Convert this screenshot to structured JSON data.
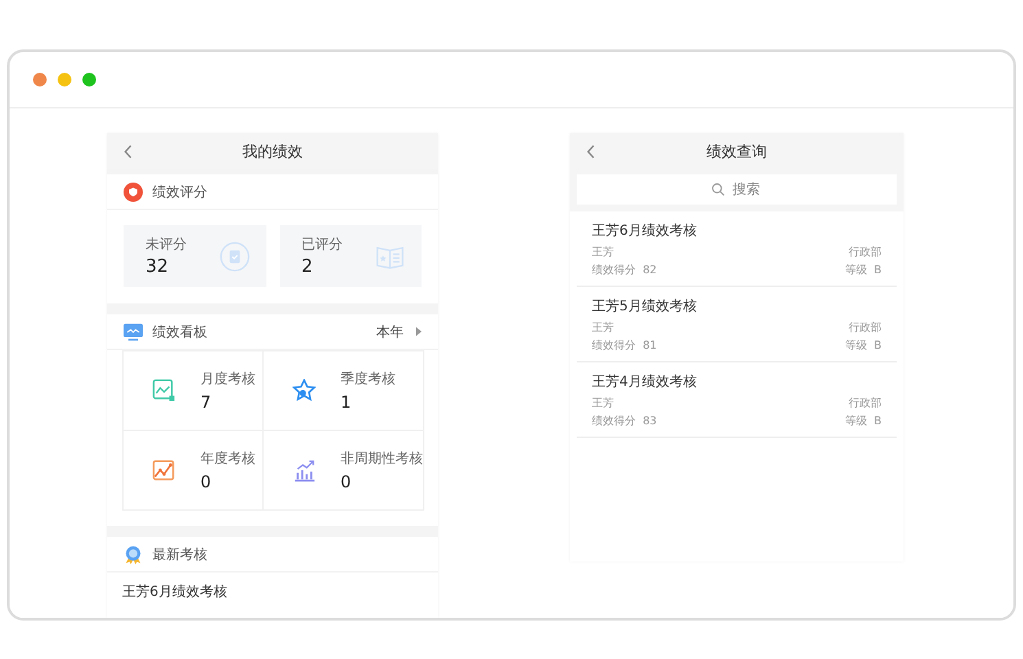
{
  "window": {
    "controls": [
      {
        "color": "#f0874a"
      },
      {
        "color": "#f5c211"
      },
      {
        "color": "#1ec31e"
      }
    ]
  },
  "left_panel": {
    "title": "我的绩效",
    "score_section": {
      "title": "绩效评分",
      "cards": [
        {
          "label": "未评分",
          "value": "32",
          "kind": "clipboard"
        },
        {
          "label": "已评分",
          "value": "2",
          "kind": "book"
        }
      ]
    },
    "board": {
      "title": "绩效看板",
      "period": "本年",
      "tiles": [
        {
          "label": "月度考核",
          "value": "7",
          "kind": "monthly"
        },
        {
          "label": "季度考核",
          "value": "1",
          "kind": "quarterly"
        },
        {
          "label": "年度考核",
          "value": "0",
          "kind": "yearly"
        },
        {
          "label": "非周期性考核",
          "value": "0",
          "kind": "irregular"
        }
      ]
    },
    "latest": {
      "title": "最新考核",
      "items": [
        "王芳6月绩效考核"
      ]
    }
  },
  "right_panel": {
    "title": "绩效查询",
    "search": {
      "placeholder": "搜索"
    },
    "records": [
      {
        "title": "王芳6月绩效考核",
        "name": "王芳",
        "department": "行政部",
        "score_label": "绩效得分",
        "score": "82",
        "grade_label": "等级",
        "grade": "B"
      },
      {
        "title": "王芳5月绩效考核",
        "name": "王芳",
        "department": "行政部",
        "score_label": "绩效得分",
        "score": "81",
        "grade_label": "等级",
        "grade": "B"
      },
      {
        "title": "王芳4月绩效考核",
        "name": "王芳",
        "department": "行政部",
        "score_label": "绩效得分",
        "score": "83",
        "grade_label": "等级",
        "grade": "B"
      }
    ]
  }
}
